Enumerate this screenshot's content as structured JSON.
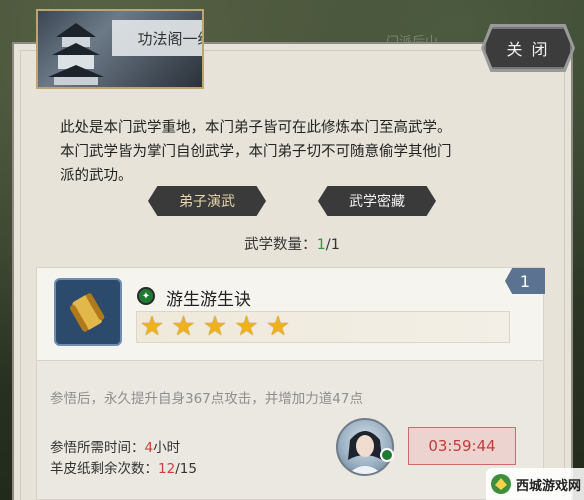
{
  "window": {
    "title": "功法阁一级",
    "background_label": "门派后山",
    "close_label": "关 闭"
  },
  "description": {
    "line1": "此处是本门武学重地，本门弟子皆可在此修炼本门至高武学。",
    "line2": "本门武学皆为掌门自创武学，本门弟子切不可随意偷学其他门",
    "line3": "派的武功。"
  },
  "tabs": [
    {
      "label": "弟子演武",
      "color": "#e8d7a8"
    },
    {
      "label": "武学密藏",
      "color": "#f3f3f3"
    }
  ],
  "skill_count": {
    "label": "武学数量：",
    "current": "1",
    "separator": "/",
    "total": "1"
  },
  "skill": {
    "index": "1",
    "name": "游生游生诀",
    "stars": 5,
    "effect": "参悟后，永久提升自身367点攻击，并增加力道47点",
    "time_label": "参悟所需时间：",
    "time_value": "4",
    "time_unit": "小时",
    "paper_label": "羊皮纸剩余次数：",
    "paper_current": "12",
    "paper_sep": "/",
    "paper_total": "15",
    "timer": "03:59:44"
  },
  "watermark": {
    "text": "西城游戏网",
    "icon": "game-logo-icon"
  },
  "colors": {
    "accent_green": "#2e9b3a",
    "timer_red": "#c23b3b",
    "badge_blue": "#5b7390"
  }
}
